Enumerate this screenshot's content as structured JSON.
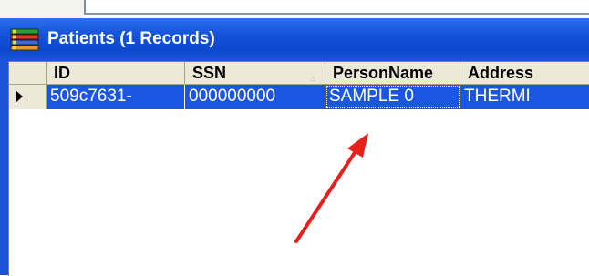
{
  "window": {
    "title": "Patients (1 Records)",
    "icon": "books-stack-icon"
  },
  "grid": {
    "columns": [
      {
        "key": "id",
        "label": "ID"
      },
      {
        "key": "ssn",
        "label": "SSN"
      },
      {
        "key": "name",
        "label": "PersonName"
      },
      {
        "key": "address",
        "label": "Address"
      }
    ],
    "sort_indicator": "▵",
    "rows": [
      {
        "id": "509c7631-",
        "ssn": "000000000",
        "name": "SAMPLE 0",
        "address": "THERMI",
        "selected": true
      }
    ]
  },
  "annotation": {
    "type": "red-arrow",
    "color": "#e8201c"
  },
  "colors": {
    "titlebar": "#1655dc",
    "selection": "#1b56e3",
    "header": "#ece9d8"
  }
}
